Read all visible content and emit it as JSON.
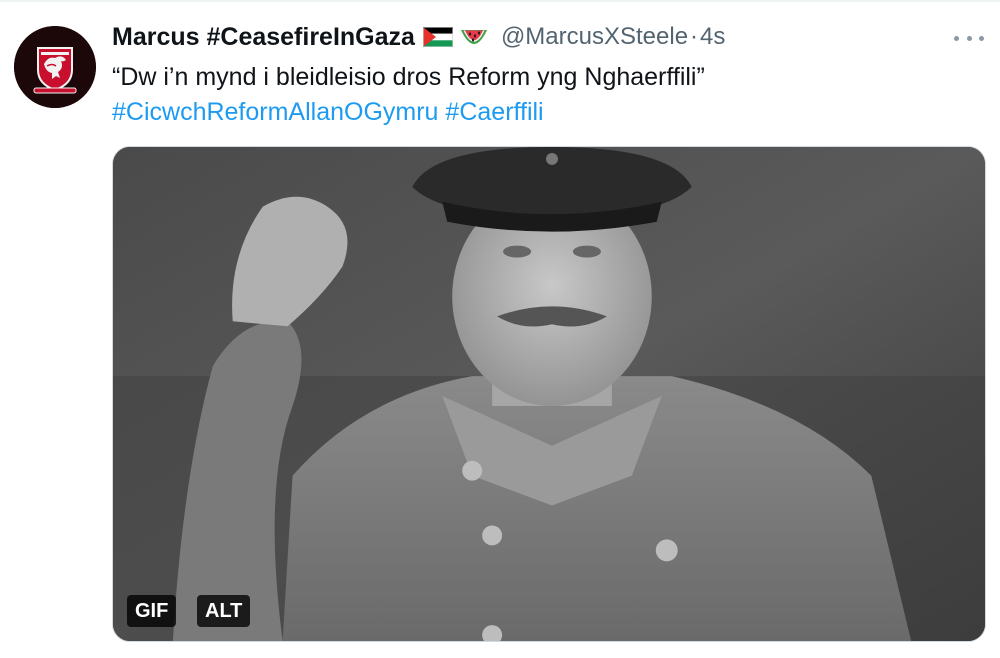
{
  "tweet": {
    "display_name": "Marcus #CeasefireInGaza",
    "handle": "@MarcusXSteele",
    "separator": "·",
    "time": "4s",
    "text": "“Dw i’n mynd i bleidleisio dros Reform yng Nghaerffili”",
    "hashtags": [
      "#CicwchReformAllanOGymru",
      "#Caerffili"
    ],
    "icons": {
      "avatar": "wales-football-crest-icon",
      "flag": "palestine-flag-icon",
      "emoji": "watermelon-icon",
      "more": "more-horizontal-icon"
    }
  },
  "media": {
    "type": "gif",
    "description_shown": false,
    "badges": {
      "gif": "GIF",
      "alt": "ALT"
    }
  },
  "colors": {
    "text": "#0f1419",
    "secondary": "#536471",
    "link": "#1d9bf0",
    "crest_red": "#c8102e"
  }
}
